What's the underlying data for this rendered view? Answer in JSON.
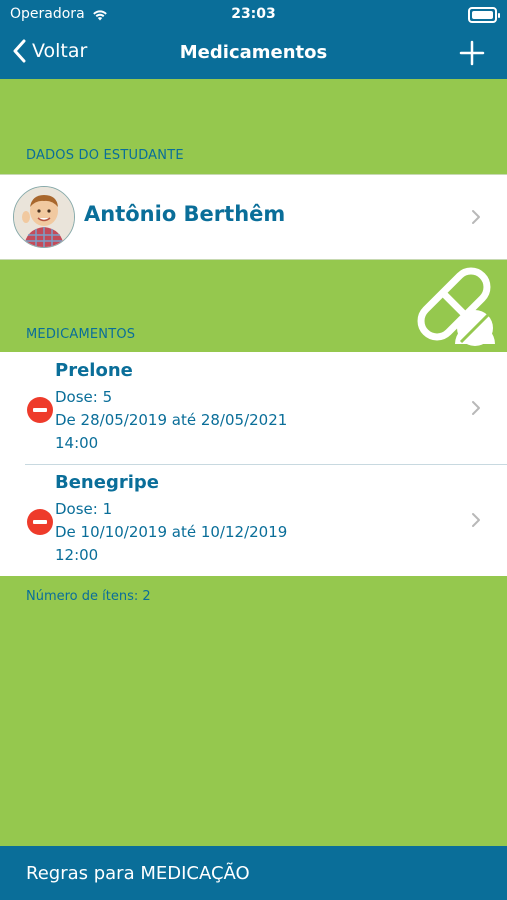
{
  "status": {
    "carrier": "Operadora",
    "time": "23:03"
  },
  "nav": {
    "back_label": "Voltar",
    "title": "Medicamentos"
  },
  "student_section": {
    "header": "DADOS DO ESTUDANTE",
    "name": "Antônio Berthêm"
  },
  "meds_section": {
    "header": "MEDICAMENTOS",
    "items": [
      {
        "name": "Prelone",
        "dose": "Dose: 5",
        "period": "De 28/05/2019 até 28/05/2021",
        "time": "14:00"
      },
      {
        "name": "Benegripe",
        "dose": "Dose: 1",
        "period": "De 10/10/2019 até 10/12/2019",
        "time": "12:00"
      }
    ],
    "count_label": "Número de ítens: 2"
  },
  "bottom": {
    "label": "Regras para MEDICAÇÃO"
  },
  "colors": {
    "primary": "#0a6e99",
    "background": "#95c84e",
    "delete": "#ee3b2b"
  }
}
